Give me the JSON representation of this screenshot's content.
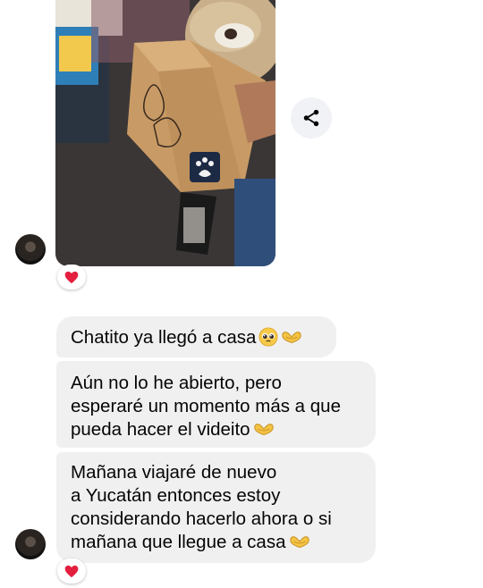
{
  "messages": [
    {
      "lines": [
        "Chatito ya llegó a casa"
      ],
      "emojis": [
        "pleading-face",
        "heart-hands"
      ]
    },
    {
      "lines": [
        "Aún no lo he abierto, pero",
        "esperaré un momento más a que",
        "pueda hacer el videito"
      ],
      "emojis": [
        "heart-hands"
      ]
    },
    {
      "lines": [
        "Mañana viajaré de nuevo",
        "a Yucatán entonces estoy",
        "considerando hacerlo ahora o si",
        "mañana que llegue a casa"
      ],
      "emojis": [
        "heart-hands"
      ]
    }
  ],
  "reactions": [
    "❤️",
    "❤️"
  ],
  "icons": {
    "share": "share-icon",
    "heart": "heart-icon"
  },
  "colors": {
    "bubble": "#f0f0f0",
    "heart": "#e41e3f",
    "share_bg": "#f0f2f5"
  }
}
